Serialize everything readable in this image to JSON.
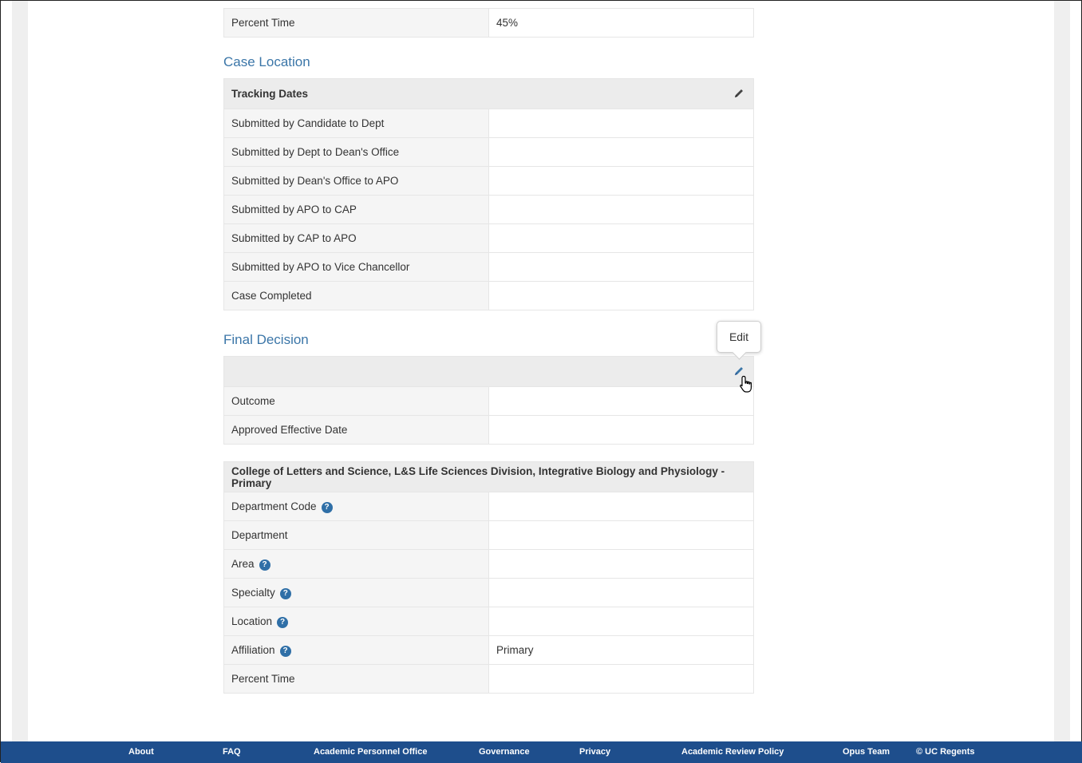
{
  "top_row": {
    "label": "Percent Time",
    "value": "45%"
  },
  "case_location": {
    "title": "Case Location",
    "header": "Tracking Dates",
    "rows": [
      {
        "label": "Submitted by Candidate to Dept",
        "value": ""
      },
      {
        "label": "Submitted by Dept to Dean's Office",
        "value": ""
      },
      {
        "label": "Submitted by Dean's Office to APO",
        "value": ""
      },
      {
        "label": "Submitted by APO to CAP",
        "value": ""
      },
      {
        "label": "Submitted by CAP to APO",
        "value": ""
      },
      {
        "label": "Submitted by APO to Vice Chancellor",
        "value": ""
      },
      {
        "label": "Case Completed",
        "value": ""
      }
    ]
  },
  "final_decision": {
    "title": "Final Decision",
    "tooltip": "Edit",
    "rows": [
      {
        "label": "Outcome",
        "value": ""
      },
      {
        "label": "Approved Effective Date",
        "value": ""
      }
    ]
  },
  "appointment": {
    "header": "College of Letters and Science, L&S Life Sciences Division, Integrative Biology and Physiology - Primary",
    "help_glyph": "?",
    "rows": [
      {
        "label": "Department Code",
        "value": "",
        "help": true
      },
      {
        "label": "Department",
        "value": "",
        "help": false
      },
      {
        "label": "Area",
        "value": "",
        "help": true
      },
      {
        "label": "Specialty",
        "value": "",
        "help": true
      },
      {
        "label": "Location",
        "value": "",
        "help": true
      },
      {
        "label": "Affiliation",
        "value": "Primary",
        "help": true
      },
      {
        "label": "Percent Time",
        "value": "",
        "help": false
      }
    ]
  },
  "footer": {
    "links": [
      "About",
      "FAQ",
      "Academic Personnel Office",
      "Governance",
      "Privacy",
      "Academic Review Policy",
      "Opus Team",
      "© UC Regents"
    ]
  },
  "colors": {
    "accent": "#3b76a8",
    "footer_bg": "#1e4e8c",
    "help_icon": "#2f6fa7"
  },
  "icons": {
    "edit": "pencil-icon",
    "help": "question-circle-icon",
    "cursor": "hand-pointer-icon"
  }
}
